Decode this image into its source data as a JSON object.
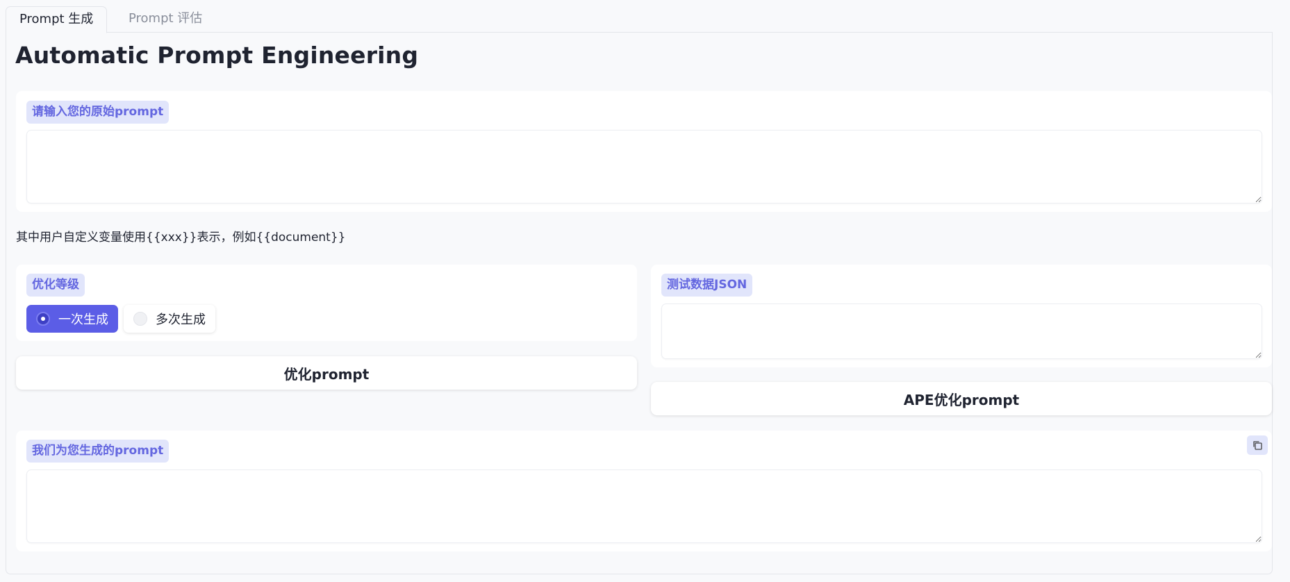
{
  "tabs": [
    {
      "label": "Prompt 生成",
      "active": true
    },
    {
      "label": "Prompt 评估",
      "active": false
    }
  ],
  "page_title": "Automatic Prompt Engineering",
  "original_prompt": {
    "label": "请输入您的原始prompt",
    "value": ""
  },
  "hint_text": "其中用户自定义变量使用{{xxx}}表示，例如{{document}}",
  "optimize_level": {
    "label": "优化等级",
    "options": [
      "一次生成",
      "多次生成"
    ],
    "selected": "一次生成"
  },
  "optimize_button": "优化prompt",
  "test_data": {
    "label": "测试数据JSON",
    "value": ""
  },
  "ape_button": "APE优化prompt",
  "generated_prompt": {
    "label": "我们为您生成的prompt",
    "value": ""
  },
  "icons": {
    "copy": "copy-icon"
  },
  "colors": {
    "accent": "#5b5de6",
    "label_bg": "#e1e5fb",
    "label_text": "#6467e0",
    "page_bg": "#f8f9fb"
  }
}
